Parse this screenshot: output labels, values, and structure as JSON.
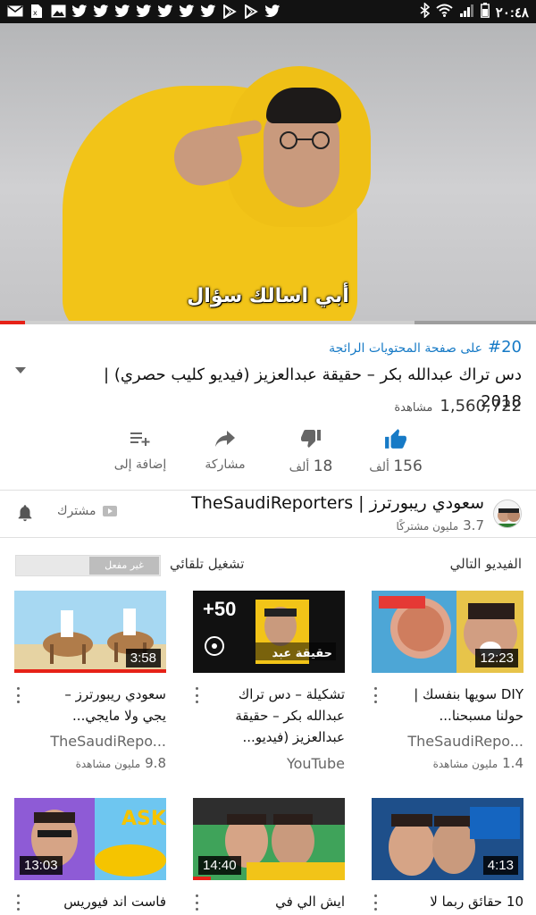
{
  "status_bar": {
    "time": "٢٠:٤٨",
    "left_icons": [
      "mail-icon",
      "sim-icon",
      "image-icon",
      "twitter-icon",
      "twitter-icon",
      "twitter-icon",
      "twitter-icon",
      "twitter-icon",
      "twitter-icon",
      "twitter-icon",
      "play-store-icon",
      "play-store-icon",
      "twitter-icon"
    ],
    "right_icons": [
      "bluetooth-icon",
      "wifi-icon",
      "signal-icon",
      "battery-icon"
    ]
  },
  "player": {
    "subtitle": "أبي اسالك سؤال",
    "progress": 0.047,
    "buffered": 0.773,
    "colors": {
      "progress": "#e62117",
      "hoodie": "#f2c418"
    }
  },
  "video": {
    "trending_rank": "#20",
    "trending_label": "على صفحة المحتويات الرائجة",
    "title": "دس تراك عبدالله بكر – حقيقة عبدالعزيز (فيديو كليب حصري) | 2018",
    "view_count": "1,560,722",
    "views_label": "مشاهدة"
  },
  "actions": {
    "like_count": "156",
    "like_unit": "ألف",
    "dislike_count": "18",
    "dislike_unit": "ألف",
    "share_label": "مشاركة",
    "add_label": "إضافة إلى",
    "accent": "#167ac6"
  },
  "channel": {
    "name": "سعودي ريبورترز | TheSaudiReporters",
    "subs_count": "3.7",
    "subs_label": "مليون مشتركًا",
    "subscribed_label": "مشترك"
  },
  "up_next": {
    "label": "الفيديو التالي",
    "autoplay_label": "تشغيل تلقائي",
    "autoplay_state": "غير مفعل"
  },
  "videos": [
    {
      "title": "DIY سويها بنفسك | حولنا مسبحنا...",
      "channel": "TheSaudiRepo...",
      "views": "1.4",
      "views_label": "مليون مشاهدة",
      "duration": "12:23"
    },
    {
      "title": "تشكيلة – دس تراك عبدالله بكر – حقيقة عبدالعزيز (فيديو...",
      "channel": "YouTube",
      "views": "",
      "views_label": "",
      "duration": "+50"
    },
    {
      "title": "سعودي ريبورترز – يجي ولا مايجي...",
      "channel": "TheSaudiRepo...",
      "views": "9.8",
      "views_label": "مليون مشاهدة",
      "duration": "3:58"
    },
    {
      "title": "10 حقائق ربما لا",
      "channel": "",
      "views": "",
      "views_label": "",
      "duration": "4:13"
    },
    {
      "title": "ايش الي في",
      "channel": "",
      "views": "",
      "views_label": "",
      "duration": "14:40"
    },
    {
      "title": "فاست اند فيوريس",
      "channel": "",
      "views": "",
      "views_label": "",
      "duration": "13:03"
    }
  ]
}
